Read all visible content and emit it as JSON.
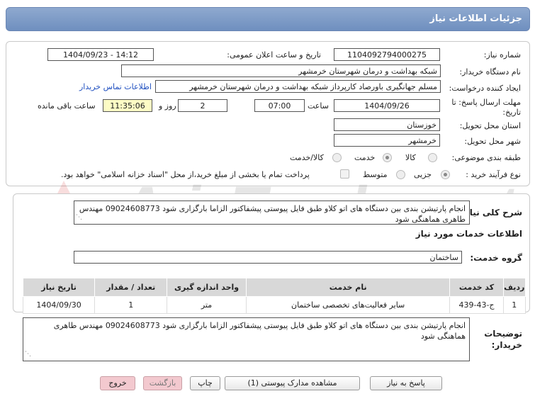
{
  "title": "جزئیات اطلاعات نیاز",
  "need_number": {
    "label": "شماره نیاز:",
    "value": "1104092794000275"
  },
  "announce_datetime": {
    "label": "تاریخ و ساعت اعلان عمومی:",
    "value": "1404/09/23 - 14:12"
  },
  "buyer_org": {
    "label": "نام دستگاه خریدار:",
    "value": "شبکه بهداشت و درمان شهرستان خرمشهر"
  },
  "requester": {
    "label": "ایجاد کننده درخواست:",
    "value": "مسلم جهانگیری باورصاد کارپرداز شبکه بهداشت و درمان شهرستان خرمشهر",
    "contact_link": "اطلاعات تماس خریدار"
  },
  "deadline": {
    "label": "مهلت ارسال پاسخ: تا تاریخ:",
    "date": "1404/09/26",
    "time_label": "ساعت",
    "time": "07:00",
    "days": "2",
    "days_label": "روز و",
    "remaining": "11:35:06",
    "remaining_label": "ساعت باقی مانده"
  },
  "province": {
    "label": "استان محل تحویل:",
    "value": "خوزستان"
  },
  "city": {
    "label": "شهر محل تحویل:",
    "value": "خرمشهر"
  },
  "category": {
    "label": "طبقه بندی موضوعی:",
    "options": [
      "کالا",
      "خدمت",
      "کالا/خدمت"
    ],
    "selected": "خدمت"
  },
  "purchase_type": {
    "label": "نوع فرآیند خرید :",
    "options": [
      "جزیی",
      "متوسط"
    ],
    "selected": "جزیی",
    "payment_note": "پرداخت تمام یا بخشی از مبلغ خرید،از محل \"اسناد خزانه اسلامی\" خواهد بود."
  },
  "summary": {
    "label": "شرح کلی نیاز:",
    "value": "انجام پارتیشن بندی بین دستگاه های اتو کلاو طبق فایل پیوستی پیشفاکتور الزاما بارگزاری شود 09024608773 مهندس طاهری هماهنگی شود"
  },
  "services_header": "اطلاعات خدمات مورد نیاز",
  "service_group": {
    "label": "گروه خدمت:",
    "value": "ساختمان"
  },
  "table": {
    "headers": [
      "ردیف",
      "کد خدمت",
      "نام خدمت",
      "واحد اندازه گیری",
      "تعداد / مقدار",
      "تاریخ نیاز"
    ],
    "rows": [
      [
        "1",
        "ج-43-439",
        "سایر فعالیت‌های تخصصی ساختمان",
        "متر",
        "1",
        "1404/09/30"
      ]
    ]
  },
  "buyer_notes": {
    "label": "توضیحات خریدار:",
    "value": "انجام پارتیشن بندی بین دستگاه های اتو کلاو طبق فایل پیوستی پیشفاکتور الزاما بارگزاری شود 09024608773 مهندس طاهری هماهنگی شود"
  },
  "buttons": {
    "reply": "پاسخ به نیاز",
    "attachments": "مشاهده مدارک پیوستی (1)",
    "print": "چاپ",
    "back": "بازگشت",
    "exit": "خروج"
  },
  "watermark": "AriaTender.net"
}
